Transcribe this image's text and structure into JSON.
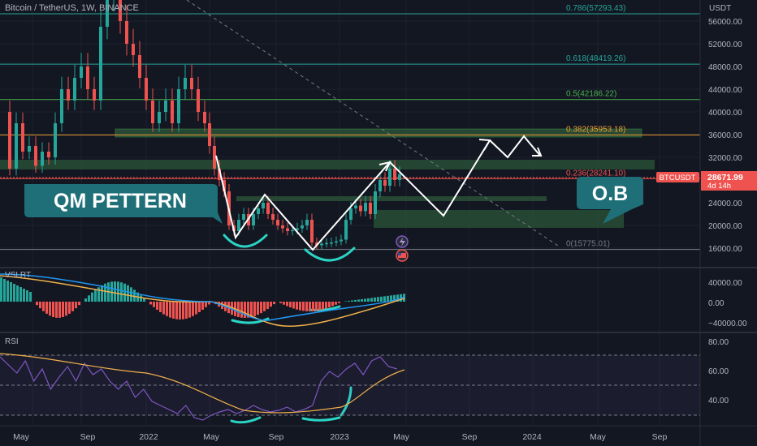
{
  "header": {
    "symbol_title": "Bitcoin / TetherUS, 1W, BINANCE",
    "currency": "USDT"
  },
  "price_axis": [
    "56000.00",
    "52000.00",
    "48000.00",
    "44000.00",
    "40000.00",
    "36000.00",
    "32000.00",
    "24000.00",
    "20000.00",
    "16000.00"
  ],
  "current_price": {
    "ticker": "BTCUSDT",
    "price": "28671.99",
    "countdown": "4d 14h",
    "value": 28671.99
  },
  "fib_levels": [
    {
      "label": "0.786(57293.43)",
      "price": 57293.43,
      "color": "#26a69a"
    },
    {
      "label": "0.618(48419.26)",
      "price": 48419.26,
      "color": "#26a69a"
    },
    {
      "label": "0.5(42186.22)",
      "price": 42186.22,
      "color": "#4caf50"
    },
    {
      "label": "0.382(35953.18)",
      "price": 35953.18,
      "color": "#f0a030"
    },
    {
      "label": "0.236(28241.10)",
      "price": 28241.1,
      "color": "#ef5350"
    },
    {
      "label": "0(15775.01)",
      "price": 15775.01,
      "color": "#787b86"
    }
  ],
  "annotations": {
    "qm_label": "QM PETTERN",
    "ob_label": "O.B"
  },
  "vslrt": {
    "label": "VSLRT",
    "axis": [
      "40000.00",
      "0.00",
      "−40000.00"
    ]
  },
  "rsi": {
    "label": "RSI",
    "axis": [
      "80.00",
      "60.00",
      "40.00"
    ]
  },
  "time_axis": [
    "May",
    "Sep",
    "2022",
    "May",
    "Sep",
    "2023",
    "May",
    "Sep",
    "2024",
    "May",
    "Sep"
  ],
  "colors": {
    "background": "#131722",
    "bullish": "#26a69a",
    "bearish": "#ef5350",
    "annotation": "#ffffff",
    "callout": "#1e6f78",
    "zone": "#2e5d3a",
    "rsi_line": "#7e57c2"
  },
  "chart_data": {
    "type": "candlestick",
    "title": "Bitcoin / TetherUS, 1W, BINANCE",
    "ylim": [
      14000,
      60000
    ],
    "y_scale": "linear",
    "x_ticks": [
      "May",
      "Sep",
      "2022",
      "May",
      "Sep",
      "2023",
      "May",
      "Sep",
      "2024",
      "May",
      "Sep"
    ],
    "series": [
      {
        "values": [
          {
            "date": "2021-05",
            "price": 38000
          },
          {
            "date": "2021-07",
            "price": 33000
          },
          {
            "date": "2021-09",
            "price": 47000
          },
          {
            "date": "2021-11",
            "price": 60000
          },
          {
            "date": "2022-01",
            "price": 40000
          },
          {
            "date": "2022-03",
            "price": 45000
          },
          {
            "date": "2022-05",
            "price": 30000
          },
          {
            "date": "2022-06",
            "price": 19000
          },
          {
            "date": "2022-08",
            "price": 23000
          },
          {
            "date": "2022-11",
            "price": 16000
          },
          {
            "date": "2023-01",
            "price": 23000
          },
          {
            "date": "2023-03",
            "price": 28000
          },
          {
            "date": "2023-04",
            "price": 29500
          }
        ]
      }
    ],
    "zones": [
      {
        "from": 35600,
        "to": 37200
      },
      {
        "from": 30500,
        "to": 32200
      },
      {
        "from": 24200,
        "to": 25000
      },
      {
        "from": 19800,
        "to": 23000
      }
    ]
  }
}
